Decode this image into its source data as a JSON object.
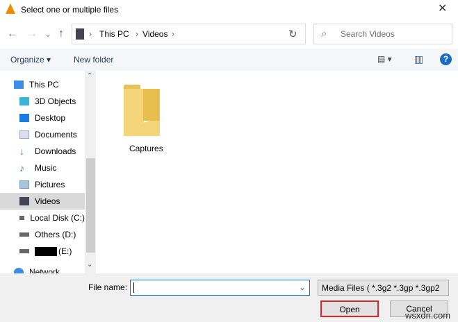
{
  "window": {
    "title": "Select one or multiple files",
    "close": "✕"
  },
  "nav": {
    "back": "←",
    "forward": "→",
    "recent": "⌄",
    "up": "↑",
    "refresh": "↻"
  },
  "address": {
    "crumbs": [
      "This PC",
      "Videos"
    ],
    "sep": "›"
  },
  "search": {
    "placeholder": "Search Videos",
    "icon": "⌕"
  },
  "toolbar": {
    "organize": "Organize ▾",
    "new_folder": "New folder",
    "view": "▤ ▾",
    "pane": "▥",
    "help": "?"
  },
  "sidebar": {
    "items": [
      {
        "label": "This PC",
        "icon": "pc-icon",
        "color": "#3a8ee6"
      },
      {
        "label": "3D Objects",
        "icon": "cube-icon",
        "color": "#39b5d8"
      },
      {
        "label": "Desktop",
        "icon": "desktop-icon",
        "color": "#1a7ce0"
      },
      {
        "label": "Documents",
        "icon": "document-icon",
        "color": "#9ab"
      },
      {
        "label": "Downloads",
        "icon": "download-icon",
        "color": "#2a7fd4"
      },
      {
        "label": "Music",
        "icon": "music-icon",
        "color": "#2a7fd4"
      },
      {
        "label": "Pictures",
        "icon": "pictures-icon",
        "color": "#7a9bb8"
      },
      {
        "label": "Videos",
        "icon": "videos-icon",
        "color": "#445"
      },
      {
        "label": "Local Disk (C:)",
        "icon": "disk-icon",
        "color": "#666"
      },
      {
        "label": "Others (D:)",
        "icon": "disk-icon",
        "color": "#666"
      },
      {
        "label": "(E:)",
        "icon": "disk-icon",
        "color": "#666"
      },
      {
        "label": "Network",
        "icon": "network-icon",
        "color": "#3a8ee6"
      }
    ]
  },
  "files": [
    {
      "name": "Captures"
    }
  ],
  "bottom": {
    "file_name_label": "File name:",
    "file_name_value": "",
    "filter": "Media Files ( *.3g2 *.3gp *.3gp2",
    "open": "Open",
    "cancel": "Cancel"
  },
  "watermark": "wsxdn.com"
}
